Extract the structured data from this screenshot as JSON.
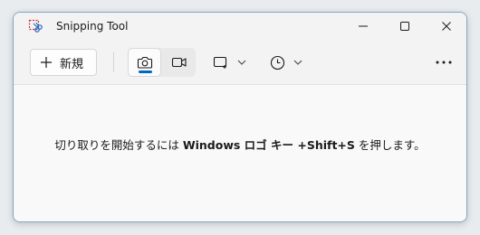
{
  "window": {
    "title": "Snipping Tool",
    "controls": {
      "minimize": "minimize-icon",
      "maximize": "maximize-icon",
      "close": "close-icon"
    }
  },
  "toolbar": {
    "new_label": "新規",
    "new_icon": "plus-icon",
    "modes": [
      {
        "icon": "camera-icon",
        "selected": true
      },
      {
        "icon": "video-camera-icon",
        "selected": false
      }
    ],
    "snip_shape_icon": "rectangle-snip-icon",
    "delay_icon": "clock-icon",
    "more_icon": "more-horizontal-icon",
    "accent_color": "#0067c0"
  },
  "content": {
    "hint_before": "切り取りを開始するには ",
    "hint_key": "Windows ロゴ キー +Shift+S",
    "hint_after": " を押します。"
  }
}
